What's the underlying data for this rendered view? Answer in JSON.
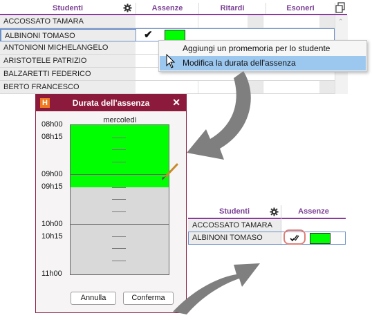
{
  "top_table": {
    "headers": {
      "students": "Studenti",
      "absences": "Assenze",
      "delays": "Ritardi",
      "exemptions": "Esoneri"
    },
    "rows": [
      {
        "name": "ACCOSSATO TAMARA"
      },
      {
        "name": "ALBINONI TOMASO",
        "absence_check": "✔",
        "selected": true
      },
      {
        "name": "ANTONIONI MICHELANGELO"
      },
      {
        "name": "ARISTOTELE PATRIZIO"
      },
      {
        "name": "BALZARETTI FEDERICO"
      },
      {
        "name": "BERTO FRANCESCO"
      }
    ]
  },
  "context_menu": {
    "items": [
      {
        "label": "Aggiungi un promemoria per lo studente"
      },
      {
        "label": "Modifica la durata dell'assenza",
        "highlighted": true
      }
    ]
  },
  "dialog": {
    "logo": "H",
    "title": "Durata dell'assenza",
    "close": "✕",
    "day": "mercoledì",
    "times": [
      "08h00",
      "08h15",
      "09h00",
      "09h15",
      "10h00",
      "10h15",
      "11h00"
    ],
    "cancel_label": "Annulla",
    "confirm_label": "Conferma"
  },
  "small_table": {
    "headers": {
      "students": "Studenti",
      "absences": "Assenze"
    },
    "rows": [
      {
        "name": "ACCOSSATO TAMARA"
      },
      {
        "name": "ALBINONI TOMASO"
      }
    ]
  },
  "colors": {
    "absence_green": "#00ff00",
    "accent_purple": "#7a3f93",
    "dialog_title": "#8b1a3c",
    "menu_highlight": "#9cc8f0",
    "arrow_gray": "#7f7f7f"
  }
}
